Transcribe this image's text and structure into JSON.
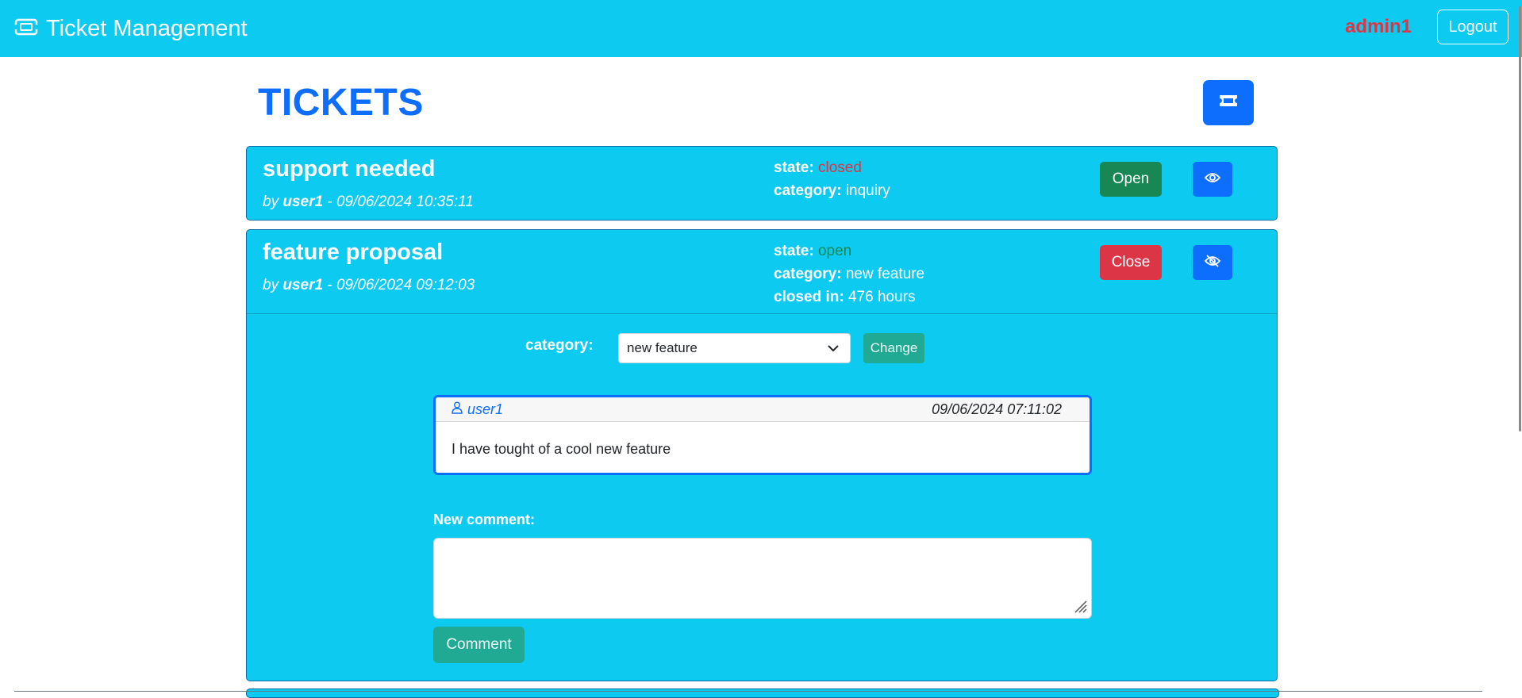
{
  "navbar": {
    "brand": "Ticket Management",
    "brand_icon": "ticket-icon",
    "user": "admin1",
    "logout_label": "Logout"
  },
  "page": {
    "title": "TICKETS",
    "new_ticket_icon": "ticket-icon"
  },
  "colors": {
    "primary": "#0d6efd",
    "info": "#0dcaf0",
    "danger": "#dc3545",
    "success": "#198754",
    "teal": "#20a993"
  },
  "tickets": [
    {
      "title": "support needed",
      "by_prefix": "by",
      "author": "user1",
      "separator": "-",
      "datetime": "09/06/2024 10:35:11",
      "state_label": "state:",
      "state": "closed",
      "category_label": "category:",
      "category": "inquiry",
      "action_label": "Open",
      "view_icon": "eye-icon"
    },
    {
      "title": "feature proposal",
      "by_prefix": "by",
      "author": "user1",
      "separator": "-",
      "datetime": "09/06/2024 09:12:03",
      "state_label": "state:",
      "state": "open",
      "category_label": "category:",
      "category": "new feature",
      "closed_in_label": "closed in:",
      "closed_in": "476 hours",
      "action_label": "Close",
      "view_icon": "eye-slash-icon",
      "details": {
        "category_label": "category:",
        "category_selected": "new feature",
        "change_label": "Change",
        "comments": [
          {
            "user": "user1",
            "user_icon": "person-icon",
            "datetime": "09/06/2024 07:11:02",
            "text": "I have tought of a cool new feature"
          }
        ],
        "new_comment_label": "New comment:",
        "new_comment_value": "",
        "comment_button": "Comment"
      }
    }
  ]
}
